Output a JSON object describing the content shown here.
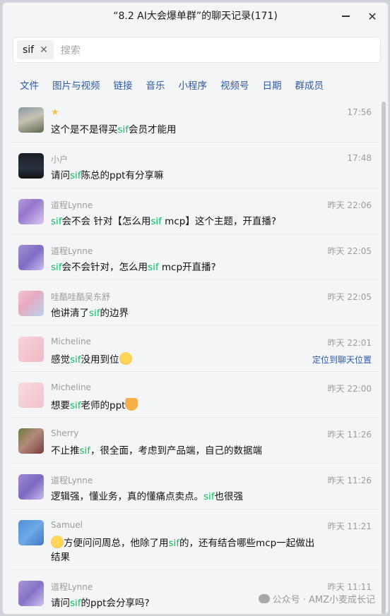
{
  "window": {
    "title": "“8.2 AI大会爆单群”的聊天记录(171)"
  },
  "search": {
    "chip": "sif",
    "placeholder": "搜索"
  },
  "tabs": [
    "文件",
    "图片与视频",
    "链接",
    "音乐",
    "小程序",
    "视频号",
    "日期",
    "群成员"
  ],
  "messages": [
    {
      "name": "",
      "badge": "★",
      "time": "17:56",
      "parts": [
        "这个是不是得买",
        "sif",
        "会员才能用"
      ]
    },
    {
      "name": "小户",
      "time": "17:48",
      "parts": [
        "请问",
        "sif",
        "陈总的ppt有分享嘛"
      ]
    },
    {
      "name": "道程Lynne",
      "time": "昨天 22:06",
      "parts": [
        "",
        "sif",
        "会不会  针对【怎么用",
        "sif",
        " mcp】这个主题，开直播?"
      ]
    },
    {
      "name": "道程Lynne",
      "time": "昨天 22:05",
      "parts": [
        "",
        "sif",
        "会不会针对，怎么用",
        "sif",
        " mcp开直播?"
      ]
    },
    {
      "name": "哇酷哇酷吴东舒",
      "time": "昨天 22:05",
      "parts": [
        "他讲清了",
        "sif",
        "的边界"
      ]
    },
    {
      "name": "Micheline",
      "time": "昨天 22:01",
      "locate": "定位到聊天位置",
      "parts": [
        "感觉",
        "sif",
        "没用到位"
      ],
      "emoji": "grimace"
    },
    {
      "name": "Micheline",
      "time": "昨天 22:00",
      "parts": [
        "想要",
        "sif",
        "老师的ppt"
      ],
      "emoji": "cat"
    },
    {
      "name": "Sherry",
      "time": "昨天 11:26",
      "parts": [
        "不止推",
        "sif",
        "，很全面，考虑到产品端，自己的数据端"
      ]
    },
    {
      "name": "道程Lynne",
      "time": "昨天 11:26",
      "parts": [
        "逻辑强，懂业务，真的懂痛点卖点。",
        "sif",
        "也很强"
      ]
    },
    {
      "name": "Samuel",
      "time": "昨天 11:21",
      "lead_emoji": "grimace",
      "parts": [
        "方便问问周总，他除了用",
        "sif",
        "的，还有结合哪些mcp一起做出结果"
      ]
    },
    {
      "name": "道程Lynne",
      "time": "昨天 11:11",
      "parts": [
        "请问",
        "sif",
        "的ppt会分享吗?"
      ]
    }
  ],
  "watermark": "公众号 · AMZ小麦成长记",
  "colors": {
    "accent": "#07c160",
    "link": "#2c5aa8"
  }
}
